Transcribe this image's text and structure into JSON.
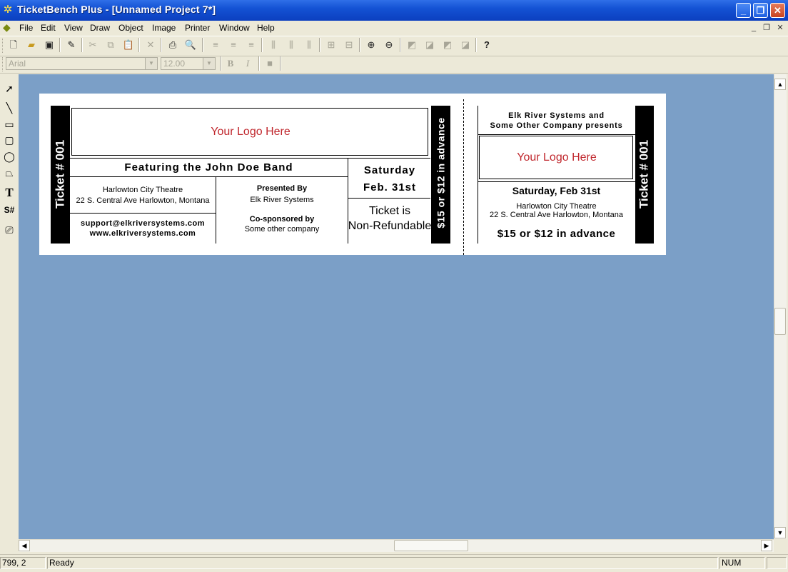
{
  "window": {
    "title": "TicketBench Plus - [Unnamed Project 7*]"
  },
  "menu": [
    "File",
    "Edit",
    "View",
    "Draw",
    "Object",
    "Image",
    "Printer",
    "Window",
    "Help"
  ],
  "format_toolbar": {
    "font": "Arial",
    "size": "12.00",
    "bold": "B",
    "italic": "I"
  },
  "ticket": {
    "stub_left": "Ticket # 001",
    "logo": "Your Logo Here",
    "feature": "Featuring the John Doe Band",
    "venue_name": "Harlowton City Theatre",
    "venue_address": "22 S. Central Ave   Harlowton, Montana",
    "email": "support@elkriversystems.com",
    "website": "www.elkriversystems.com",
    "presented_by_label": "Presented By",
    "presenter": "Elk River Systems",
    "cosponsored_label": "Co-sponsored by",
    "cosponsor": "Some other company",
    "day": "Saturday",
    "date": "Feb. 31st",
    "refund_1": "Ticket is",
    "refund_2": "Non-Refundable",
    "price_vertical": "$15 or $12 in advance",
    "right_header_1": "Elk River Systems and",
    "right_header_2": "Some Other Company presents",
    "right_logo": "Your Logo Here",
    "right_date": "Saturday, Feb 31st",
    "right_venue": "Harlowton City Theatre",
    "right_address": "22 S. Central Ave   Harlowton, Montana",
    "right_price": "$15 or $12 in advance",
    "stub_right": "Ticket # 001"
  },
  "status": {
    "coords": "799, 2",
    "message": "Ready",
    "num": "NUM"
  },
  "colors": {
    "workspace": "#7B9FC7",
    "logo_text": "#C0272D",
    "titlebar": "#1452D4"
  }
}
